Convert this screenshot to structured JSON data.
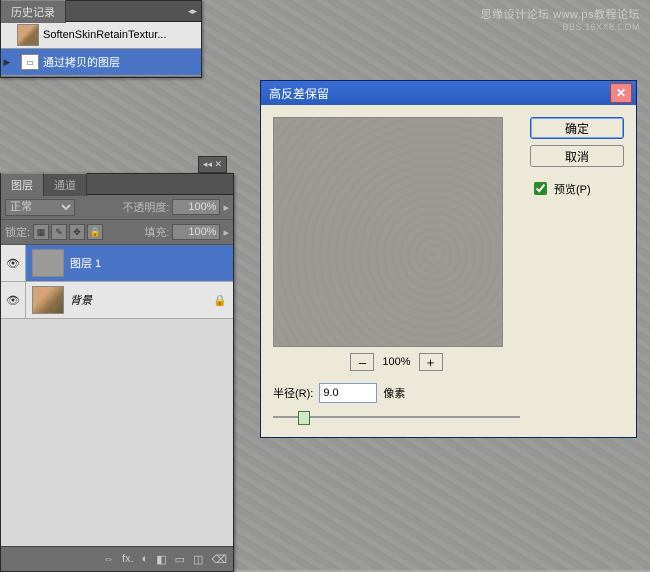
{
  "watermark": {
    "line1": "思缘设计论坛 www.ps教程论坛",
    "line2": "BBS.16XX8.COM"
  },
  "history": {
    "tab": "历史记录",
    "rows": [
      {
        "label": "SoftenSkinRetainTextur...",
        "active": false
      },
      {
        "label": "通过拷贝的图层",
        "active": true
      }
    ]
  },
  "layers": {
    "tabs": [
      "图层",
      "通道"
    ],
    "blend_mode": "正常",
    "opacity_label": "不透明度:",
    "opacity_value": "100%",
    "lock_label": "锁定:",
    "fill_label": "填充:",
    "fill_value": "100%",
    "rows": [
      {
        "name": "图层 1",
        "selected": true,
        "locked": false,
        "bgthumb": false
      },
      {
        "name": "背景",
        "selected": false,
        "locked": true,
        "bgthumb": true
      }
    ],
    "footer_icons": [
      "⇔",
      "fx.",
      "◐",
      "◧",
      "▭",
      "◫",
      "⌫"
    ]
  },
  "dialog": {
    "title": "高反差保留",
    "ok": "确定",
    "cancel": "取消",
    "preview_label": "预览(P)",
    "preview_checked": true,
    "zoom_value": "100%",
    "zoom_minus": "–",
    "zoom_plus": "+",
    "radius_label": "半径(R):",
    "radius_value": "9.0",
    "radius_unit": "像素"
  }
}
